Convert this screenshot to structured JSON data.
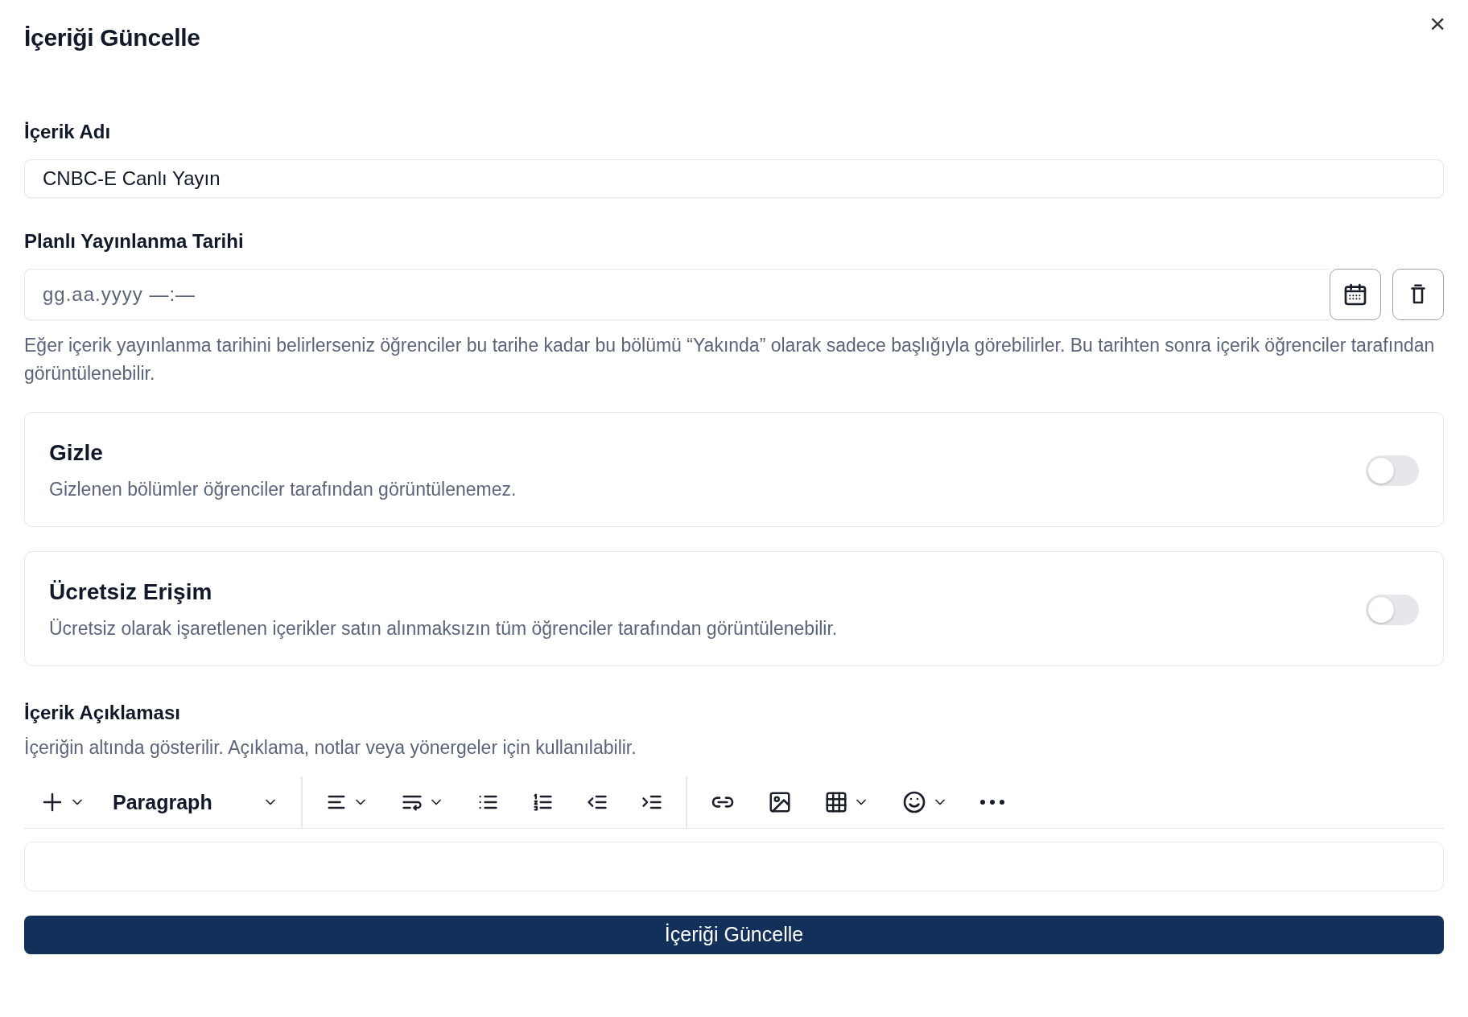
{
  "dialog": {
    "title": "İçeriği Güncelle",
    "close": "×"
  },
  "name_field": {
    "label": "İçerik Adı",
    "value": "CNBC-E Canlı Yayın"
  },
  "date_field": {
    "label": "Planlı Yayınlanma Tarihi",
    "placeholder": "gg.aa.yyyy —:—",
    "help": "Eğer içerik yayınlanma tarihini belirlerseniz öğrenciler bu tarihe kadar bu bölümü “Yakında” olarak sadece başlığıyla görebilirler. Bu tarihten sonra içerik öğrenciler tarafından görüntülenebilir."
  },
  "toggles": [
    {
      "title": "Gizle",
      "description": "Gizlenen bölümler öğrenciler tarafından görüntülenemez.",
      "on": false
    },
    {
      "title": "Ücretsiz Erişim",
      "description": "Ücretsiz olarak işaretlenen içerikler satın alınmaksızın tüm öğrenciler tarafından görüntülenebilir.",
      "on": false
    }
  ],
  "description_editor": {
    "label": "İçerik Açıklaması",
    "help": "İçeriğin altında gösterilir. Açıklama, notlar veya yönergeler için kullanılabilir.",
    "block_style": "Paragraph"
  },
  "submit": "İçeriği Güncelle"
}
